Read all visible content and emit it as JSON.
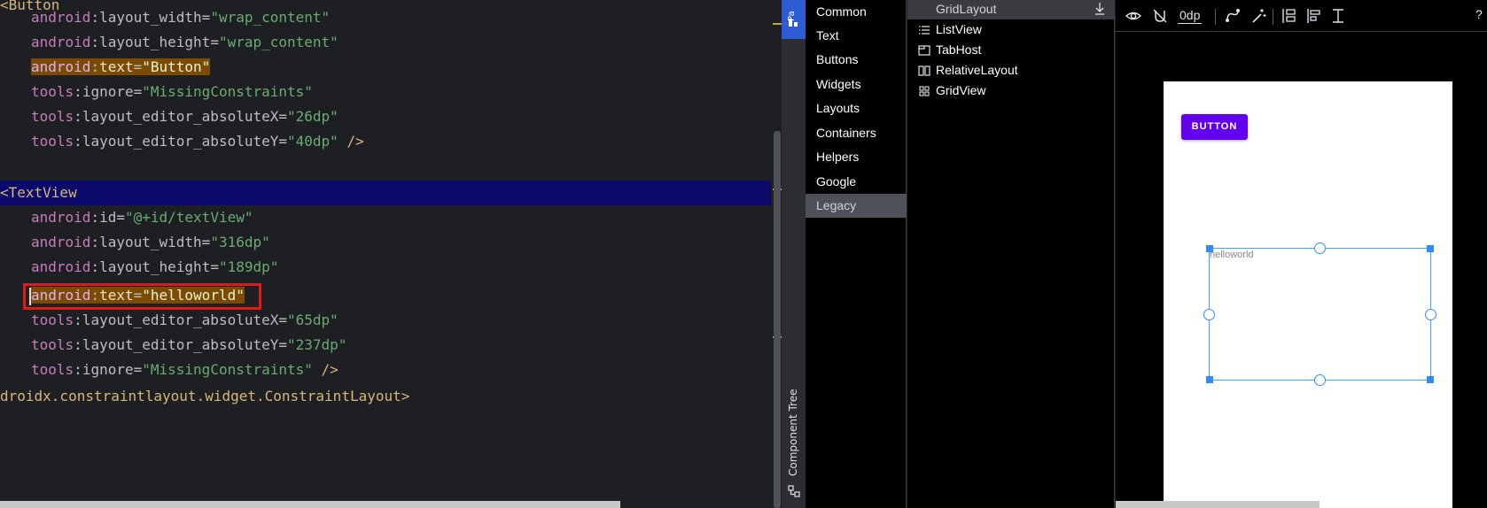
{
  "editor": {
    "lines": [
      {
        "tag": "<Button"
      },
      {
        "ns": "android",
        "attr": "layout_width",
        "value": "\"wrap_content\""
      },
      {
        "ns": "android",
        "attr": "layout_height",
        "value": "\"wrap_content\""
      },
      {
        "ns": "android",
        "attr": "text",
        "value": "\"Button\""
      },
      {
        "ns": "tools",
        "attr": "ignore",
        "value": "\"MissingConstraints\""
      },
      {
        "ns": "tools",
        "attr": "layout_editor_absoluteX",
        "value": "\"26dp\""
      },
      {
        "ns": "tools",
        "attr": "layout_editor_absoluteY",
        "value": "\"40dp\"",
        "close": " />"
      },
      {
        "tag": "<TextView"
      },
      {
        "ns": "android",
        "attr": "id",
        "value": "\"@+id/textView\""
      },
      {
        "ns": "android",
        "attr": "layout_width",
        "value": "\"316dp\""
      },
      {
        "ns": "android",
        "attr": "layout_height",
        "value": "\"189dp\""
      },
      {
        "ns": "android",
        "attr": "text",
        "value": "\"helloworld\""
      },
      {
        "ns": "tools",
        "attr": "layout_editor_absoluteX",
        "value": "\"65dp\""
      },
      {
        "ns": "tools",
        "attr": "layout_editor_absoluteY",
        "value": "\"237dp\""
      },
      {
        "ns": "tools",
        "attr": "ignore",
        "value": "\"MissingConstraints\"",
        "close": " />"
      },
      {
        "tag": "droidx.constraintlayout.widget.ConstraintLayout>"
      }
    ]
  },
  "side_strip": {
    "palette_tab": "Pa",
    "component_tree": "Component Tree"
  },
  "palette": {
    "categories": [
      "Common",
      "Text",
      "Buttons",
      "Widgets",
      "Layouts",
      "Containers",
      "Helpers",
      "Google",
      "Legacy"
    ],
    "selected_category": "Legacy",
    "widgets": [
      {
        "label": "GridLayout",
        "icon": "gridlayout-icon"
      },
      {
        "label": "ListView",
        "icon": "list-icon"
      },
      {
        "label": "TabHost",
        "icon": "tabhost-icon"
      },
      {
        "label": "RelativeLayout",
        "icon": "relativelayout-icon"
      },
      {
        "label": "GridView",
        "icon": "grid-icon"
      }
    ]
  },
  "design": {
    "toolbar": {
      "margin_value": "0dp",
      "help": "?"
    },
    "button_text": "BUTTON",
    "textview_text": "helloworld"
  },
  "colors": {
    "editor_bg": "#1e1f22",
    "tag": "#d5b778",
    "namespace": "#c77dbb",
    "string": "#6aab73",
    "line_highlight": "#0b0a6b",
    "selection": "#7a4b00",
    "red_box": "#e01818",
    "palette_tab": "#2f5bd6",
    "material_button": "#6200ee",
    "selection_handles": "#2f8bff"
  }
}
